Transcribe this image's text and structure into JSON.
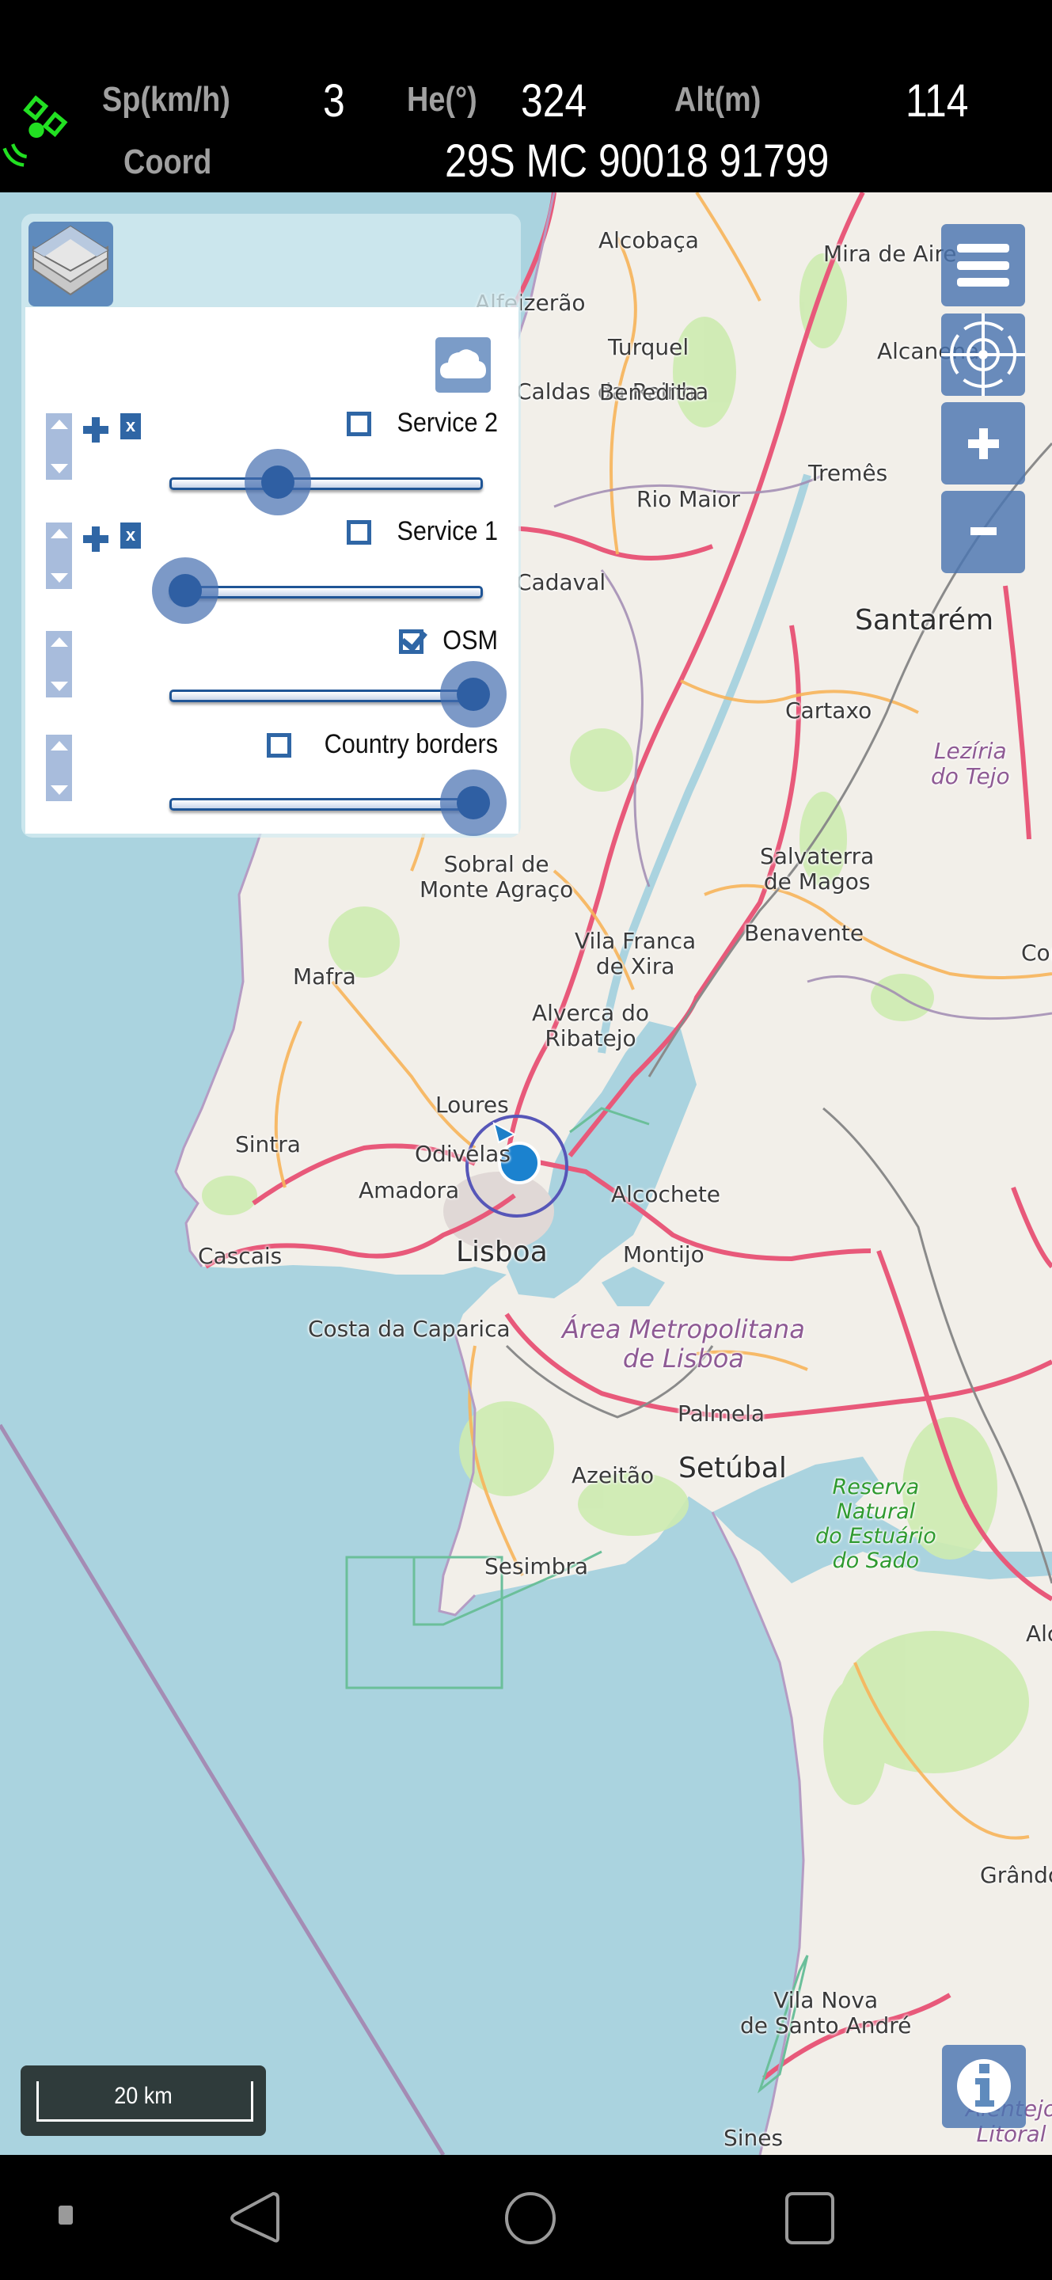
{
  "header": {
    "gps_icon": "satellite-icon",
    "gps_color": "#22e022",
    "speed_label": "Sp(km/h)",
    "speed_value": "3",
    "heading_label": "He(°)",
    "heading_value": "324",
    "altitude_label": "Alt(m)",
    "altitude_value": "114",
    "coord_label": "Coord",
    "coord_value": "29S MC 90018 91799"
  },
  "layer_panel": {
    "layers_icon": "layers-icon",
    "cloud_icon": "cloud-icon",
    "layers": [
      {
        "name": "Service 2",
        "checked": false,
        "opacity": 0.35,
        "removable": true
      },
      {
        "name": "Service 1",
        "checked": false,
        "opacity": 0.05,
        "removable": true
      },
      {
        "name": "OSM",
        "checked": true,
        "opacity": 1.0,
        "removable": false
      },
      {
        "name": "Country borders",
        "checked": false,
        "opacity": 1.0,
        "removable": false
      }
    ],
    "remove_label": "x"
  },
  "controls": {
    "menu_icon": "menu-icon",
    "locate_icon": "crosshair-icon",
    "zoom_in_icon": "zoom-in-icon",
    "zoom_out_icon": "zoom-out-icon",
    "info_icon": "info-icon"
  },
  "scale_bar": {
    "label": "20 km"
  },
  "map": {
    "places": [
      {
        "name": "Alcobaça"
      },
      {
        "name": "Mira de Aire"
      },
      {
        "name": "Alfeizerão"
      },
      {
        "name": "Turquel"
      },
      {
        "name": "Alcanena"
      },
      {
        "name": "Caldas da Rainha"
      },
      {
        "name": "Benedita"
      },
      {
        "name": "Tremês"
      },
      {
        "name": "Rio Maior"
      },
      {
        "name": "Cadaval"
      },
      {
        "name": "Santarém"
      },
      {
        "name": "Cartaxo"
      },
      {
        "name": "Lezíria\ndo Tejo"
      },
      {
        "name": "Salvaterra\nde Magos"
      },
      {
        "name": "Benavente"
      },
      {
        "name": "Coruche"
      },
      {
        "name": "Sobral de\nMonte Agraço"
      },
      {
        "name": "Vila Franca\nde Xira"
      },
      {
        "name": "Mafra"
      },
      {
        "name": "Alverca do\nRibatejo"
      },
      {
        "name": "Loures"
      },
      {
        "name": "Sintra"
      },
      {
        "name": "Odivelas"
      },
      {
        "name": "Amadora"
      },
      {
        "name": "Alcochete"
      },
      {
        "name": "Cascais"
      },
      {
        "name": "Lisboa"
      },
      {
        "name": "Montijo"
      },
      {
        "name": "Costa da Caparica"
      },
      {
        "name": "Área Metropolitana\nde Lisboa"
      },
      {
        "name": "Palmela"
      },
      {
        "name": "Azeitão"
      },
      {
        "name": "Setúbal"
      },
      {
        "name": "Reserva\nNatural\ndo Estuário\ndo Sado"
      },
      {
        "name": "Sesimbra"
      },
      {
        "name": "Alcácer do Sal"
      },
      {
        "name": "Grândola"
      },
      {
        "name": "Vila Nova\nde Santo André"
      },
      {
        "name": "Sines"
      },
      {
        "name": "Alentejo\nLitoral"
      }
    ],
    "location_marker": "current-location-marker"
  },
  "navbar": {
    "menu_icon": "nav-menu-icon",
    "back_icon": "nav-back-icon",
    "home_icon": "nav-home-icon",
    "recents_icon": "nav-recents-icon"
  }
}
